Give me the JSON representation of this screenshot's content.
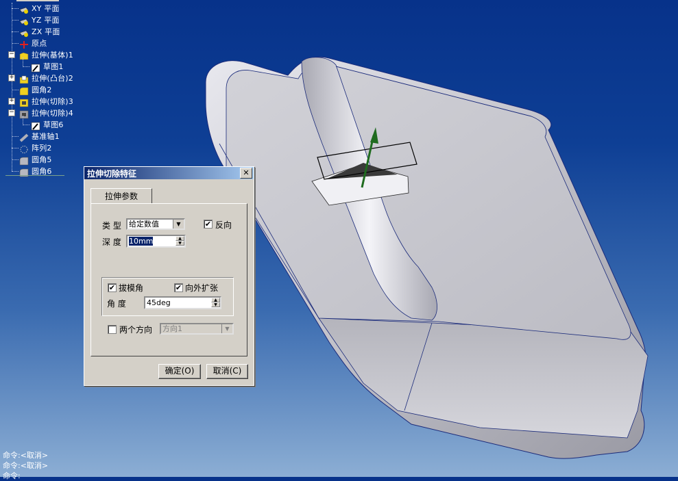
{
  "feature_tree": {
    "items": [
      {
        "label": "XY 平面",
        "icon": "plane-icon"
      },
      {
        "label": "YZ 平面",
        "icon": "plane-icon"
      },
      {
        "label": "ZX 平面",
        "icon": "plane-icon"
      },
      {
        "label": "原点",
        "icon": "origin-icon"
      },
      {
        "label": "拉伸(基体)1",
        "icon": "extrude-base-icon"
      },
      {
        "label": "草图1",
        "icon": "sketch-icon"
      },
      {
        "label": "拉伸(凸台)2",
        "icon": "extrude-boss-icon"
      },
      {
        "label": "圆角2",
        "icon": "fillet-icon"
      },
      {
        "label": "拉伸(切除)3",
        "icon": "extrude-cut-icon"
      },
      {
        "label": "拉伸(切除)4",
        "icon": "extrude-cut-icon"
      },
      {
        "label": "草图6",
        "icon": "sketch-icon"
      },
      {
        "label": "基准轴1",
        "icon": "axis-icon"
      },
      {
        "label": "阵列2",
        "icon": "pattern-icon"
      },
      {
        "label": "圆角5",
        "icon": "fillet-icon"
      },
      {
        "label": "圆角6",
        "icon": "fillet-icon"
      }
    ]
  },
  "dialog": {
    "title": "拉伸切除特征",
    "close_label": "✕",
    "tab_label": "拉伸参数",
    "type_label": "类 型",
    "type_value": "给定数值",
    "reverse_label": "反向",
    "reverse_checked": true,
    "depth_label": "深 度",
    "depth_value": "10mm",
    "draft_label": "拔模角",
    "draft_checked": true,
    "outward_label": "向外扩张",
    "outward_checked": true,
    "angle_label": "角  度",
    "angle_value": "45deg",
    "two_dir_label": "两个方向",
    "two_dir_checked": false,
    "direction_value": "方向1",
    "ok_label": "确定(O)",
    "cancel_label": "取消(C)"
  },
  "command_lines": [
    "命令:<取消>",
    "命令:<取消>",
    "命令:"
  ],
  "colors": {
    "background_top": "#07328a",
    "background_bottom": "#8caed4",
    "titlebar": "#0a246a",
    "model_face": "#c9c9d0",
    "axis_arrow": "#1f6b1f"
  }
}
